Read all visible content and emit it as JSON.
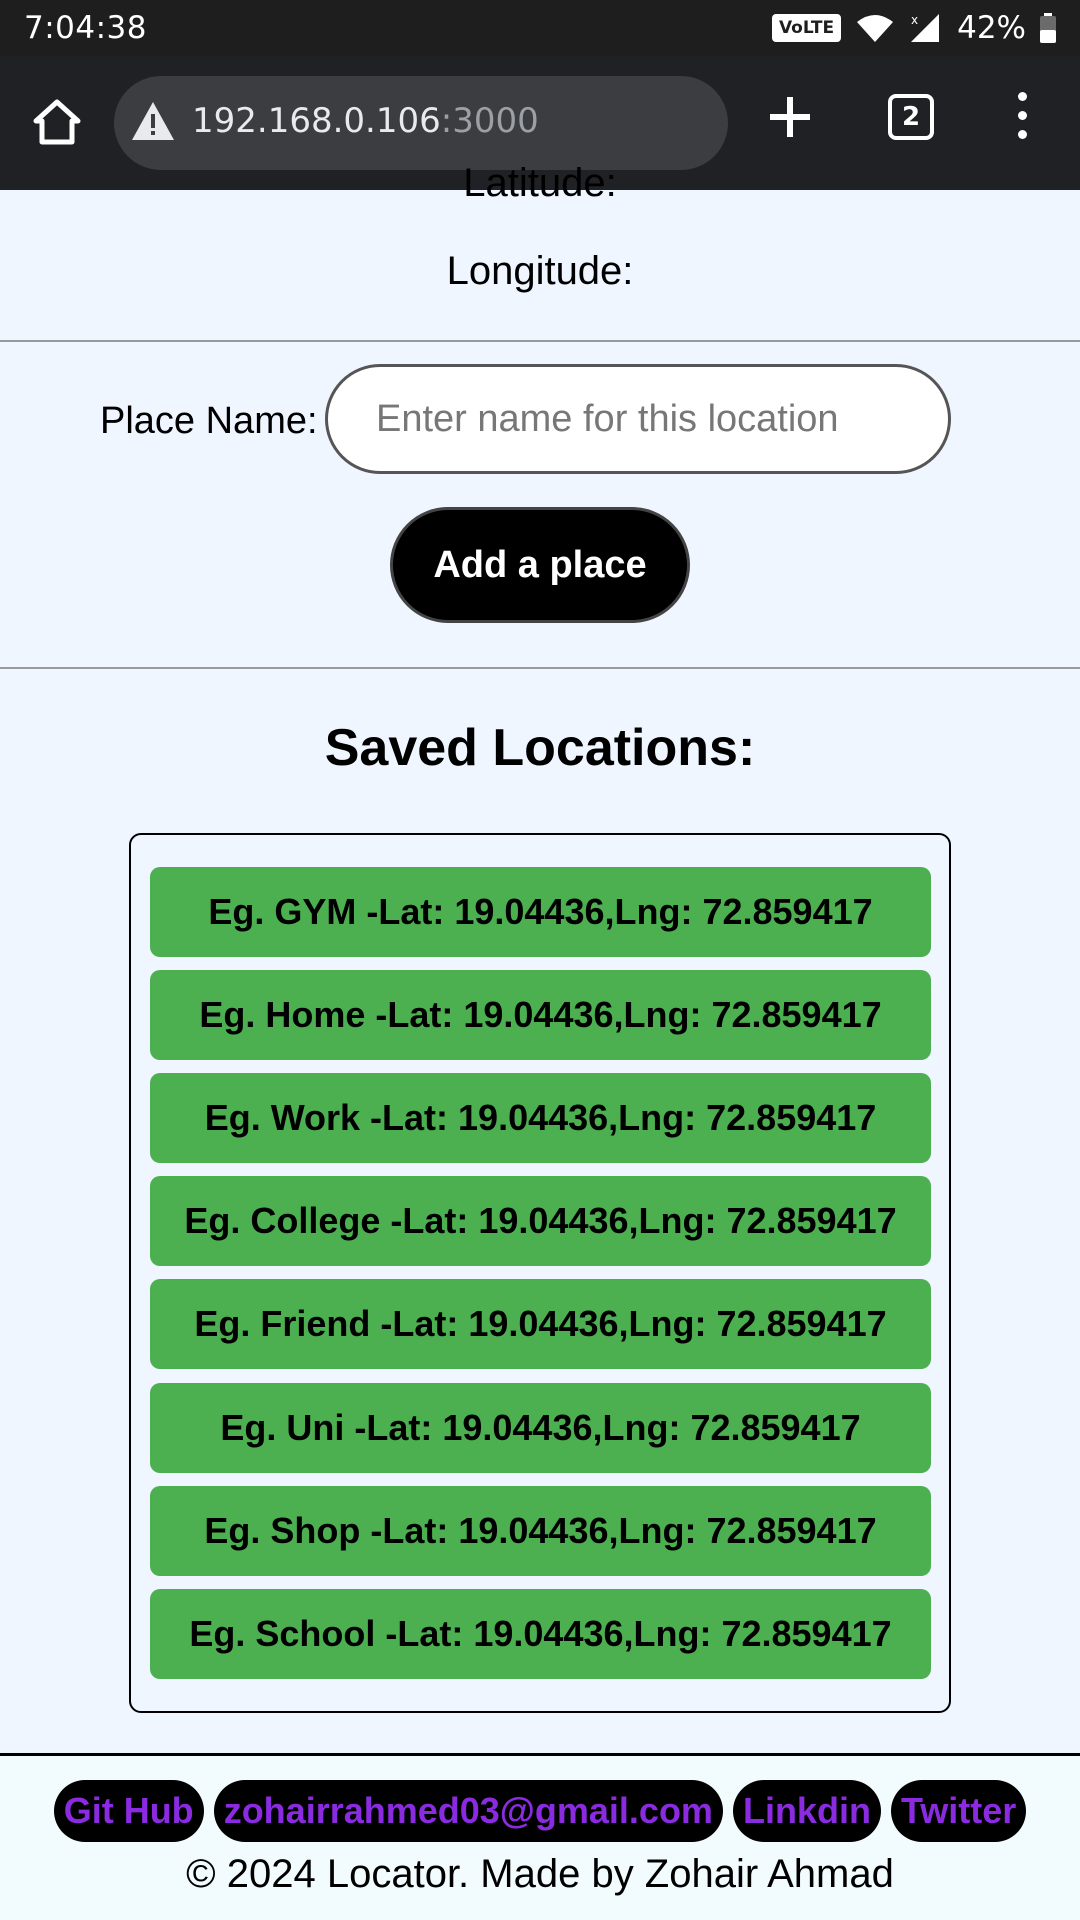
{
  "status_bar": {
    "time": "7:04:38",
    "network_badge": "VoLTE",
    "battery_percent": "42%",
    "icons": [
      "volte-icon",
      "wifi-icon",
      "cell-signal-icon",
      "battery-icon"
    ]
  },
  "browser": {
    "url_host": "192.168.0.106",
    "url_port": ":3000",
    "tab_count": "2",
    "icons": [
      "home-icon",
      "not-secure-warning-icon",
      "plus-icon",
      "tab-switcher-icon",
      "more-vert-icon"
    ]
  },
  "coords": {
    "latitude_label": "Latitude:",
    "longitude_label": "Longitude:"
  },
  "form": {
    "place_name_label": "Place Name:",
    "place_input_value": "",
    "place_input_placeholder": "Enter name for this location",
    "add_button_label": "Add a place"
  },
  "saved": {
    "title": "Saved Locations:",
    "items": [
      "Eg. GYM -Lat: 19.04436,Lng: 72.859417",
      "Eg. Home -Lat: 19.04436,Lng: 72.859417",
      "Eg. Work -Lat: 19.04436,Lng: 72.859417",
      "Eg. College -Lat: 19.04436,Lng: 72.859417",
      "Eg. Friend -Lat: 19.04436,Lng: 72.859417",
      "Eg. Uni -Lat: 19.04436,Lng: 72.859417",
      "Eg. Shop -Lat: 19.04436,Lng: 72.859417",
      "Eg. School -Lat: 19.04436,Lng: 72.859417"
    ]
  },
  "footer": {
    "links": [
      "Git Hub",
      "zohairrahmed03@gmail.com",
      "Linkdin",
      "Twitter"
    ],
    "copyright": "© 2024 Locator. Made by Zohair Ahmad"
  },
  "colors": {
    "page_bg": "#f0f6ff",
    "item_green": "#4caf50",
    "link_purple": "#8a2be2",
    "toolbar_dark": "#202124"
  }
}
